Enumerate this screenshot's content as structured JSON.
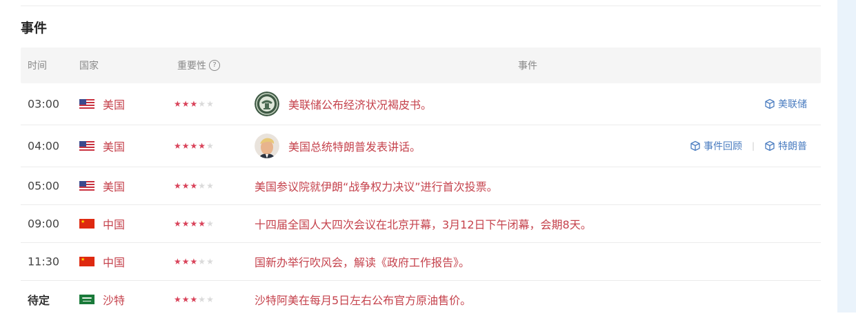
{
  "section": {
    "title": "事件"
  },
  "columns": {
    "time": "时间",
    "country": "国家",
    "importance": "重要性",
    "help": "?",
    "event": "事件"
  },
  "colors": {
    "accent_red": "#c5424c",
    "star_on": "#d9435a",
    "tag_blue": "#4a7cc0",
    "header_bg": "#f5f5f5"
  },
  "rows": [
    {
      "time": "03:00",
      "country": "美国",
      "flag": "us",
      "stars": 3,
      "max_stars": 5,
      "avatar": "fed-seal-icon",
      "event": "美联储公布经济状况褐皮书。",
      "tags": [
        "美联储"
      ]
    },
    {
      "time": "04:00",
      "country": "美国",
      "flag": "us",
      "stars": 4,
      "max_stars": 5,
      "avatar": "person-portrait-icon",
      "event": "美国总统特朗普发表讲话。",
      "tags": [
        "事件回顾",
        "特朗普"
      ]
    },
    {
      "time": "05:00",
      "country": "美国",
      "flag": "us",
      "stars": 3,
      "max_stars": 5,
      "event": "美国参议院就伊朗“战争权力决议”进行首次投票。",
      "tags": []
    },
    {
      "time": "09:00",
      "country": "中国",
      "flag": "cn",
      "stars": 4,
      "max_stars": 5,
      "event": "十四届全国人大四次会议在北京开幕，3月12日下午闭幕，会期8天。",
      "tags": []
    },
    {
      "time": "11:30",
      "country": "中国",
      "flag": "cn",
      "stars": 3,
      "max_stars": 5,
      "event": "国新办举行吹风会，解读《政府工作报告》。",
      "tags": []
    },
    {
      "time": "待定",
      "country": "沙特",
      "flag": "sa",
      "stars": 3,
      "max_stars": 5,
      "event": "沙特阿美在每月5日左右公布官方原油售价。",
      "tags": []
    }
  ]
}
